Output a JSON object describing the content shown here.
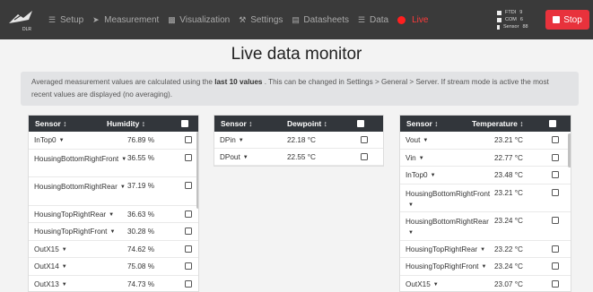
{
  "navbar": {
    "logo_text": "DLR",
    "menu": [
      {
        "label": "Setup",
        "icon": "database-icon"
      },
      {
        "label": "Measurement",
        "icon": "rocket-icon"
      },
      {
        "label": "Visualization",
        "icon": "bar-chart-icon"
      },
      {
        "label": "Settings",
        "icon": "wrench-icon"
      },
      {
        "label": "Datasheets",
        "icon": "file-icon"
      },
      {
        "label": "Data",
        "icon": "database-icon"
      },
      {
        "label": "Live",
        "icon": "record-dot-icon"
      }
    ],
    "status": [
      {
        "label": "FTDI",
        "value": "9"
      },
      {
        "label": "COM",
        "value": "6"
      },
      {
        "label": "Sensor",
        "value": "88"
      }
    ],
    "stop_label": "Stop"
  },
  "page": {
    "title": "Live data monitor",
    "info_pre": "Averaged measurement values are calculated using the ",
    "info_bold": "last 10 values",
    "info_post": " . This can be changed in Settings > General > Server. If stream mode is active the most recent values are displayed (no averaging)."
  },
  "humidity_table": {
    "headers": [
      "Sensor ↕",
      "Humidity ↕"
    ],
    "rows": [
      {
        "sensor": "InTop0",
        "value": "76.89 %"
      },
      {
        "sensor": "HousingBottomRightFront",
        "value": "36.55 %"
      },
      {
        "sensor": "HousingBottomRightRear",
        "value": "37.19 %"
      },
      {
        "sensor": "HousingTopRightRear",
        "value": "36.63 %"
      },
      {
        "sensor": "HousingTopRightFront",
        "value": "30.28 %"
      },
      {
        "sensor": "OutX15",
        "value": "74.62 %"
      },
      {
        "sensor": "OutX14",
        "value": "75.08 %"
      },
      {
        "sensor": "OutX13",
        "value": "74.73 %"
      }
    ]
  },
  "dewpoint_table": {
    "headers": [
      "Sensor ↕",
      "Dewpoint ↕"
    ],
    "rows": [
      {
        "sensor": "DPin",
        "value": "22.18 °C"
      },
      {
        "sensor": "DPout",
        "value": "22.55 °C"
      }
    ]
  },
  "temperature_table": {
    "headers": [
      "Sensor ↕",
      "Temperature ↕"
    ],
    "rows": [
      {
        "sensor": "Vout",
        "value": "23.21 °C"
      },
      {
        "sensor": "Vin",
        "value": "22.77 °C"
      },
      {
        "sensor": "InTop0",
        "value": "23.48 °C"
      },
      {
        "sensor": "HousingBottomRightFront",
        "value": "23.21 °C"
      },
      {
        "sensor": "HousingBottomRightRear",
        "value": "23.24 °C"
      },
      {
        "sensor": "HousingTopRightRear",
        "value": "23.22 °C"
      },
      {
        "sensor": "HousingTopRightFront",
        "value": "23.24 °C"
      },
      {
        "sensor": "OutX15",
        "value": "23.07 °C"
      }
    ]
  }
}
